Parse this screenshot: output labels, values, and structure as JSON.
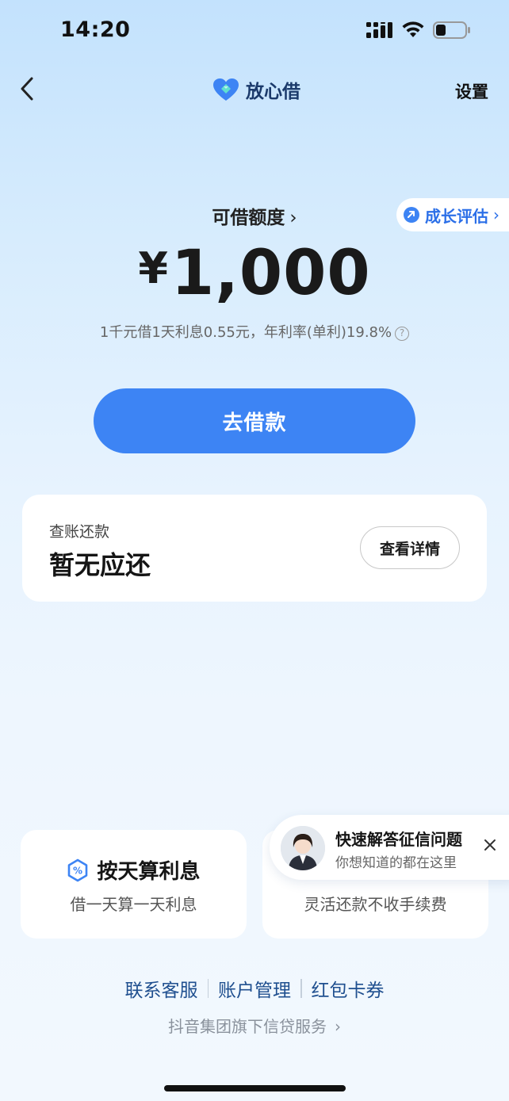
{
  "status_bar": {
    "time": "14:20"
  },
  "nav": {
    "brand_name": "放心借",
    "settings_label": "设置"
  },
  "quota": {
    "label": "可借额度",
    "currency_symbol": "¥",
    "amount": "1,000",
    "note": "1千元借1天利息0.55元，年利率(单利)19.8%",
    "growth_label": "成长评估"
  },
  "borrow_button_label": "去借款",
  "bill": {
    "title": "查账还款",
    "status": "暂无应还",
    "detail_button": "查看详情"
  },
  "features": [
    {
      "title": "按天算利息",
      "subtitle": "借一天算一天利息",
      "icon": "percent-hexagon-icon"
    },
    {
      "subtitle": "灵活还款不收手续费"
    }
  ],
  "popup": {
    "title": "快速解答征信问题",
    "subtitle": "你想知道的都在这里"
  },
  "footer": {
    "links": [
      "联系客服",
      "账户管理",
      "红包卡券"
    ],
    "group_note": "抖音集团旗下信贷服务"
  },
  "colors": {
    "primary": "#3d84f4",
    "link": "#1f4f8f"
  }
}
